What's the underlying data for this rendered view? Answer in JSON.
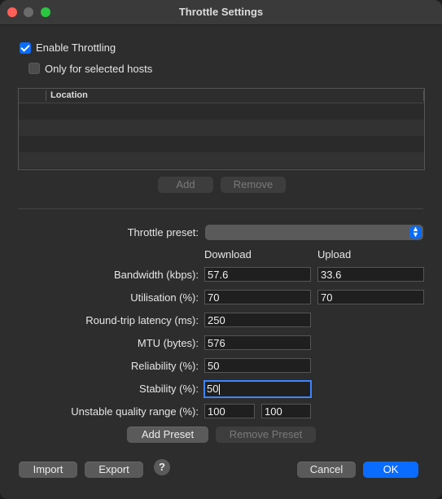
{
  "window": {
    "title": "Throttle Settings"
  },
  "options": {
    "enable_throttling": {
      "label": "Enable Throttling",
      "checked": true
    },
    "only_selected_hosts": {
      "label": "Only for selected hosts",
      "checked": false
    }
  },
  "hosts_table": {
    "columns": [
      "Location"
    ],
    "rows": []
  },
  "hosts_buttons": {
    "add": "Add",
    "remove": "Remove"
  },
  "preset": {
    "label": "Throttle preset:",
    "value": ""
  },
  "columns": {
    "download": "Download",
    "upload": "Upload"
  },
  "fields": {
    "bandwidth": {
      "label": "Bandwidth (kbps):",
      "download": "57.6",
      "upload": "33.6"
    },
    "utilisation": {
      "label": "Utilisation (%):",
      "download": "70",
      "upload": "70"
    },
    "latency": {
      "label": "Round-trip latency (ms):",
      "value": "250"
    },
    "mtu": {
      "label": "MTU (bytes):",
      "value": "576"
    },
    "reliability": {
      "label": "Reliability (%):",
      "value": "50"
    },
    "stability": {
      "label": "Stability (%):",
      "value": "50"
    },
    "unstable_range": {
      "label": "Unstable quality range (%):",
      "min": "100",
      "max": "100"
    }
  },
  "preset_buttons": {
    "add": "Add Preset",
    "remove": "Remove Preset"
  },
  "footer": {
    "import": "Import",
    "export": "Export",
    "help": "?",
    "cancel": "Cancel",
    "ok": "OK"
  },
  "colors": {
    "accent": "#0a6cff",
    "window_bg": "#2d2d2d",
    "close": "#ff5f57",
    "maximize": "#2ac840"
  }
}
